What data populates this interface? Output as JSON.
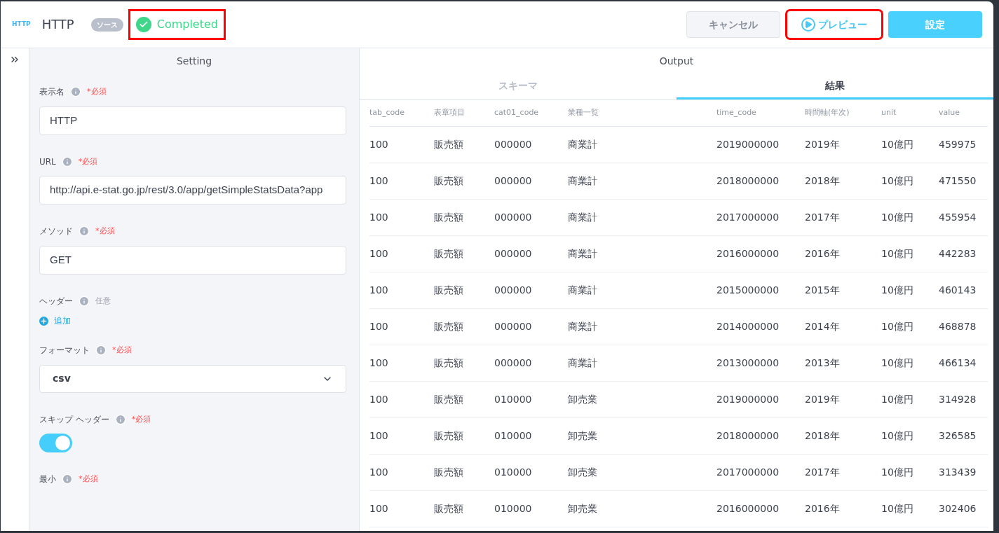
{
  "header": {
    "logo": "HTTP",
    "title": "HTTP",
    "badge": "ソース",
    "status": {
      "label": "Completed",
      "highlighted": true
    },
    "buttons": [
      {
        "label": "キャンセル",
        "kind": "secondary",
        "highlighted": false
      },
      {
        "label": "プレビュー",
        "kind": "preview",
        "highlighted": true
      },
      {
        "label": "設定",
        "kind": "primary",
        "highlighted": false
      }
    ]
  },
  "setting": {
    "title": "Setting",
    "fields": [
      {
        "label": "表示名",
        "requirement": "*必須",
        "required": true,
        "kind": "input",
        "value": "HTTP"
      },
      {
        "label": "URL",
        "requirement": "*必須",
        "required": true,
        "kind": "input",
        "value": "http://api.e-stat.go.jp/rest/3.0/app/getSimpleStatsData?app"
      },
      {
        "label": "メソッド",
        "requirement": "*必須",
        "required": true,
        "kind": "input",
        "value": "GET"
      },
      {
        "label": "ヘッダー",
        "requirement": "任意",
        "required": false,
        "kind": "add",
        "action": "追加"
      },
      {
        "label": "フォーマット",
        "requirement": "*必須",
        "required": true,
        "kind": "select",
        "value": "csv"
      },
      {
        "label": "スキップ ヘッダー",
        "requirement": "*必須",
        "required": true,
        "kind": "toggle",
        "on": true
      },
      {
        "label": "最小",
        "requirement": "*必須",
        "required": true,
        "kind": "label"
      }
    ]
  },
  "output": {
    "title": "Output",
    "tabs": [
      {
        "label": "スキーマ",
        "selected": false
      },
      {
        "label": "結果",
        "selected": true
      }
    ],
    "table": {
      "columns": [
        "tab_code",
        "表章項目",
        "cat01_code",
        "業種一覧",
        "time_code",
        "時間軸(年次)",
        "unit",
        "value"
      ],
      "rows": [
        [
          "100",
          "販売額",
          "000000",
          "商業計",
          "2019000000",
          "2019年",
          "10億円",
          "459975"
        ],
        [
          "100",
          "販売額",
          "000000",
          "商業計",
          "2018000000",
          "2018年",
          "10億円",
          "471550"
        ],
        [
          "100",
          "販売額",
          "000000",
          "商業計",
          "2017000000",
          "2017年",
          "10億円",
          "455954"
        ],
        [
          "100",
          "販売額",
          "000000",
          "商業計",
          "2016000000",
          "2016年",
          "10億円",
          "442283"
        ],
        [
          "100",
          "販売額",
          "000000",
          "商業計",
          "2015000000",
          "2015年",
          "10億円",
          "460143"
        ],
        [
          "100",
          "販売額",
          "000000",
          "商業計",
          "2014000000",
          "2014年",
          "10億円",
          "468878"
        ],
        [
          "100",
          "販売額",
          "000000",
          "商業計",
          "2013000000",
          "2013年",
          "10億円",
          "466134"
        ],
        [
          "100",
          "販売額",
          "010000",
          "卸売業",
          "2019000000",
          "2019年",
          "10億円",
          "314928"
        ],
        [
          "100",
          "販売額",
          "010000",
          "卸売業",
          "2018000000",
          "2018年",
          "10億円",
          "326585"
        ],
        [
          "100",
          "販売額",
          "010000",
          "卸売業",
          "2017000000",
          "2017年",
          "10億円",
          "313439"
        ],
        [
          "100",
          "販売額",
          "010000",
          "卸売業",
          "2016000000",
          "2016年",
          "10億円",
          "302406"
        ]
      ]
    }
  }
}
